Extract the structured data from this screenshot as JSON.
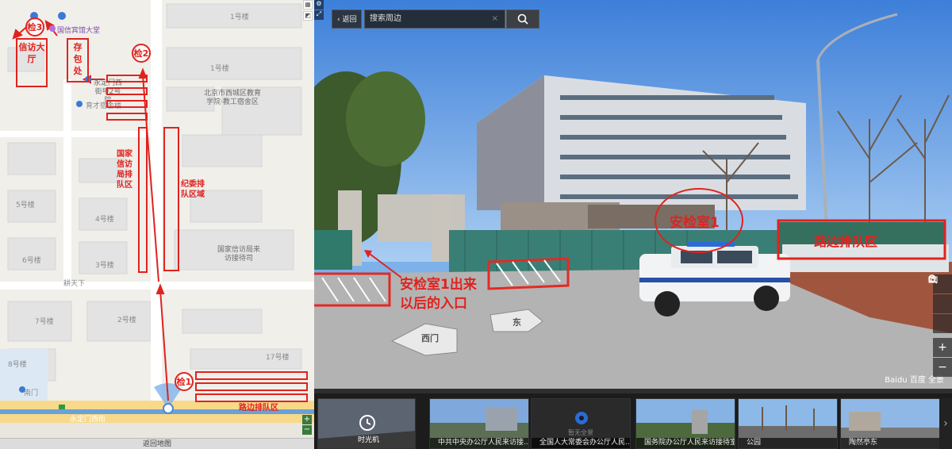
{
  "map": {
    "buildings": {
      "b1": "1号楼",
      "b1b": "1号楼",
      "b5": "5号楼",
      "b4": "4号楼",
      "b6": "6号楼",
      "b3": "3号楼",
      "b7": "7号楼",
      "b2": "2号楼",
      "b17": "17号楼",
      "b8": "8号楼"
    },
    "poi_hotel": "国信宾馆大堂",
    "poi_courtyard": "永定门西街甲2号院",
    "poi_dorm": "育才宿舍楼",
    "poi_school": "北京市西城区教育学院·教工宿舍区",
    "poi_office": "国家信访局来访接待司",
    "poi_village": "耕天下",
    "poi_south_gate": "南门",
    "road_name": "永定门西街",
    "checkpoint_1": "检1",
    "checkpoint_2": "检2",
    "checkpoint_3": "检3",
    "petition_hall": "信访大厅",
    "storage": "存包处",
    "national_queue": "国家信访局排队区",
    "discipline_queue": "纪委排队区域",
    "roadside_queue": "路边排队区",
    "footer": "返回地图"
  },
  "pano": {
    "back_label": "返回",
    "search_placeholder": "搜索周边",
    "security_room": "安检室1",
    "entrance_note_1": "安检室1出来",
    "entrance_note_2": "以后的入口",
    "roadside_queue": "路边排队区",
    "arrow_west": "西门",
    "arrow_east": "东",
    "logo": "Baidu 百度 全景"
  },
  "filmstrip": {
    "items": [
      {
        "caption": "时光机"
      },
      {
        "caption": "中共中央办公厅人民来访接..."
      },
      {
        "caption": "全国人大常委会办公厅人民..."
      },
      {
        "caption": "国务院办公厅人民来访接待室"
      },
      {
        "caption": "公园"
      },
      {
        "caption": "陶然亭东"
      }
    ],
    "overlay_text": "暂无全景"
  },
  "colors": {
    "annotation_red": "#e0231f",
    "sky": "#7cb1ea",
    "road": "#b5b5b5"
  }
}
